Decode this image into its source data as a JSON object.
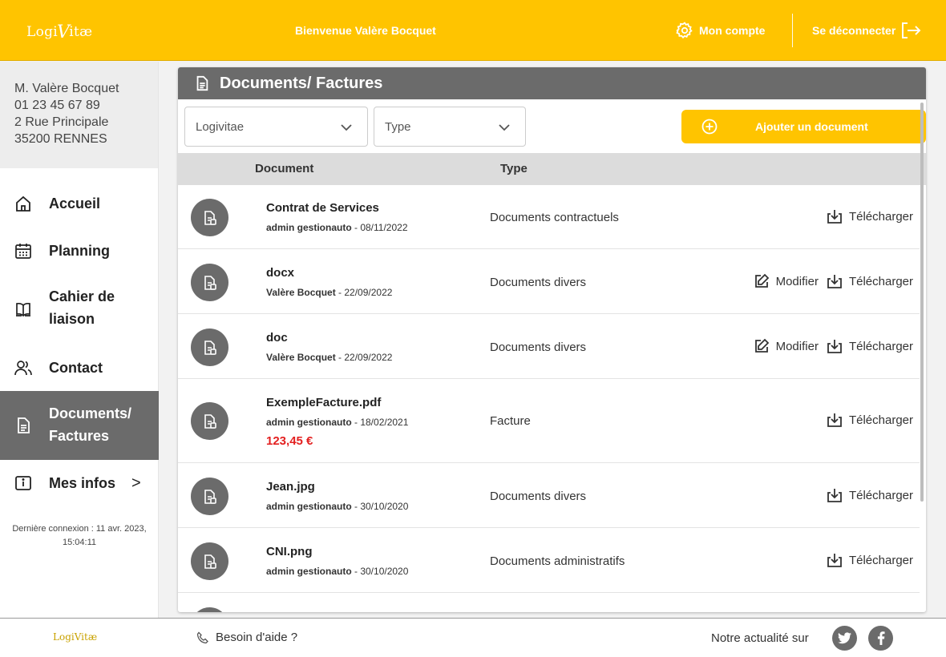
{
  "header": {
    "logo_a": "Logi",
    "logo_v": "V",
    "logo_b": "itæ",
    "welcome": "Bienvenue Valère Bocquet",
    "account": "Mon compte",
    "logout": "Se déconnecter"
  },
  "user": {
    "name": "M. Valère Bocquet",
    "phone": "01 23 45 67 89",
    "address1": "2 Rue Principale",
    "address2": "35200 RENNES"
  },
  "nav": {
    "accueil": "Accueil",
    "planning": "Planning",
    "cahier_1": "Cahier de",
    "cahier_2": "liaison",
    "contact": "Contact",
    "documents_1": "Documents/",
    "documents_2": "Factures",
    "infos": "Mes infos",
    "infos_chevron": ">"
  },
  "last_login": {
    "line1": "Dernière connexion : 11 avr. 2023,",
    "line2": "15:04:11"
  },
  "panel": {
    "title": "Documents/ Factures",
    "filter_company": "Logivitae",
    "filter_type": "Type",
    "add_button": "Ajouter un document",
    "col_document": "Document",
    "col_type": "Type"
  },
  "actions": {
    "modify": "Modifier",
    "download": "Télécharger"
  },
  "documents": [
    {
      "name": "Contrat de Services",
      "author": "admin gestionauto",
      "date": " - 08/11/2022",
      "type": "Documents contractuels",
      "price": ""
    },
    {
      "name": "docx",
      "author": "Valère Bocquet",
      "date": " - 22/09/2022",
      "type": "Documents divers",
      "price": ""
    },
    {
      "name": "doc",
      "author": "Valère Bocquet",
      "date": " - 22/09/2022",
      "type": "Documents divers",
      "price": ""
    },
    {
      "name": "ExempleFacture.pdf",
      "author": "admin gestionauto",
      "date": " - 18/02/2021",
      "type": "Facture",
      "price": "123,45 €"
    },
    {
      "name": "Jean.jpg",
      "author": "admin gestionauto",
      "date": " - 30/10/2020",
      "type": "Documents divers",
      "price": ""
    },
    {
      "name": "CNI.png",
      "author": "admin gestionauto",
      "date": " - 30/10/2020",
      "type": "Documents administratifs",
      "price": ""
    }
  ],
  "footer": {
    "logo": "LogiVitæ",
    "help": "Besoin d'aide ?",
    "news": "Notre actualité sur"
  },
  "colors": {
    "accent": "#ffc400",
    "dark": "#6b6b6b",
    "price": "#e32020"
  },
  "icons": [
    "gear-icon",
    "logout-icon",
    "home-icon",
    "calendar-icon",
    "book-icon",
    "contact-icon",
    "document-icon",
    "info-icon",
    "chevron-down-icon",
    "plus-circle-icon",
    "file-icon",
    "edit-icon",
    "download-icon",
    "phone-icon",
    "twitter-icon",
    "facebook-icon"
  ]
}
